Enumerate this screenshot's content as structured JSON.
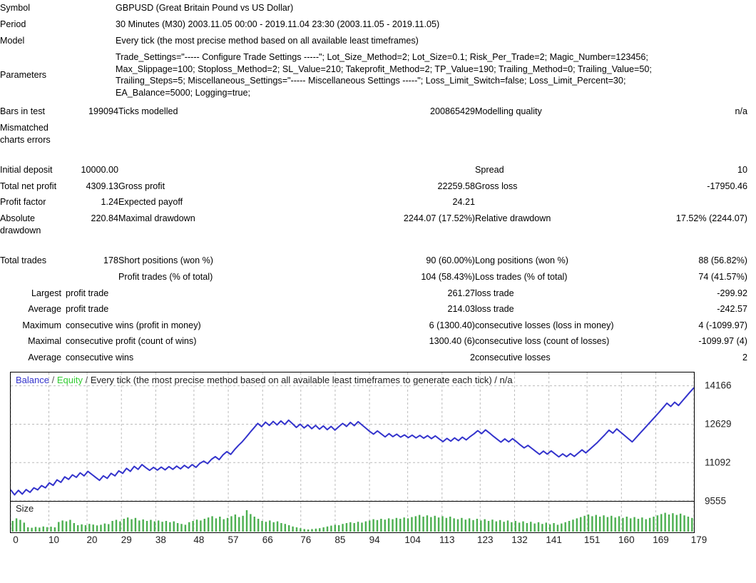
{
  "header": {
    "rows": [
      {
        "label": "Symbol",
        "value": "GBPUSD (Great Britain Pound vs US Dollar)"
      },
      {
        "label": "Period",
        "value": "30 Minutes (M30) 2003.11.05 00:00 - 2019.11.04 23:30 (2003.11.05 - 2019.11.05)"
      },
      {
        "label": "Model",
        "value": "Every tick (the most precise method based on all available least timeframes)"
      }
    ],
    "parameters_label": "Parameters",
    "parameters_lines": [
      "Trade_Settings=\"----- Configure Trade Settings -----\"; Lot_Size_Method=2; Lot_Size=0.1; Risk_Per_Trade=2; Magic_Number=123456;",
      "Max_Slippage=100; Stoploss_Method=2; SL_Value=210; Takeprofit_Method=2; TP_Value=190; Trailing_Method=0; Trailing_Value=50;",
      "Trailing_Steps=5; Miscellaneous_Settings=\"----- Miscellaneous Settings -----\"; Loss_Limit_Switch=false; Loss_Limit_Percent=30;",
      "EA_Balance=5000; Logging=true;"
    ]
  },
  "stats": {
    "bars_in_test_label": "Bars in test",
    "bars_in_test_value": "199094",
    "ticks_modelled_label": "Ticks modelled",
    "ticks_modelled_value": "200865429",
    "modelling_quality_label": "Modelling quality",
    "modelling_quality_value": "n/a",
    "mismatched_label": "Mismatched charts errors",
    "mismatched_value": "",
    "initial_deposit_label": "Initial deposit",
    "initial_deposit_value": "10000.00",
    "spread_label": "Spread",
    "spread_value": "10",
    "total_net_profit_label": "Total net profit",
    "total_net_profit_value": "4309.13",
    "gross_profit_label": "Gross profit",
    "gross_profit_value": "22259.58",
    "gross_loss_label": "Gross loss",
    "gross_loss_value": "-17950.46",
    "profit_factor_label": "Profit factor",
    "profit_factor_value": "1.24",
    "expected_payoff_label": "Expected payoff",
    "expected_payoff_value": "24.21",
    "absolute_drawdown_label": "Absolute drawdown",
    "absolute_drawdown_value": "220.84",
    "maximal_drawdown_label": "Maximal drawdown",
    "maximal_drawdown_value": "2244.07 (17.52%)",
    "relative_drawdown_label": "Relative drawdown",
    "relative_drawdown_value": "17.52% (2244.07)",
    "total_trades_label": "Total trades",
    "total_trades_value": "178",
    "short_positions_label": "Short positions (won %)",
    "short_positions_value": "90 (60.00%)",
    "long_positions_label": "Long positions (won %)",
    "long_positions_value": "88 (56.82%)",
    "profit_trades_label": "Profit trades (% of total)",
    "profit_trades_value": "104 (58.43%)",
    "loss_trades_label": "Loss trades (% of total)",
    "loss_trades_value": "74 (41.57%)",
    "largest_label": "Largest",
    "largest_profit_trade_label": "profit trade",
    "largest_profit_trade_value": "261.27",
    "largest_loss_trade_label": "loss trade",
    "largest_loss_trade_value": "-299.92",
    "average_label": "Average",
    "average_profit_trade_label": "profit trade",
    "average_profit_trade_value": "214.03",
    "average_loss_trade_label": "loss trade",
    "average_loss_trade_value": "-242.57",
    "maximum_label": "Maximum",
    "max_consecutive_wins_label": "consecutive wins (profit in money)",
    "max_consecutive_wins_value": "6 (1300.40)",
    "max_consecutive_losses_label": "consecutive losses (loss in money)",
    "max_consecutive_losses_value": "4 (-1099.97)",
    "maximal_label": "Maximal",
    "maximal_consecutive_profit_label": "consecutive profit (count of wins)",
    "maximal_consecutive_profit_value": "1300.40 (6)",
    "maximal_consecutive_loss_label": "consecutive loss (count of losses)",
    "maximal_consecutive_loss_value": "-1099.97 (4)",
    "average2_label": "Average",
    "avg_consecutive_wins_label": "consecutive wins",
    "avg_consecutive_wins_value": "2",
    "avg_consecutive_losses_label": "consecutive losses",
    "avg_consecutive_losses_value": "2"
  },
  "chart_legend": {
    "balance": "Balance",
    "equity": "Equity",
    "sep": "/",
    "rest": "Every tick (the most precise method based on all available least timeframes to generate each tick) / n/a",
    "size_label": "Size",
    "balance_color": "#3333cc",
    "equity_color": "#33cc33",
    "bar_color": "#4caf50"
  },
  "chart_data": {
    "type": "line",
    "title": "Balance / Equity / Every tick (the most precise method based on all available least timeframes to generate each tick) / n/a",
    "xlabel": "",
    "ylabel": "",
    "ylim": [
      9555,
      14700
    ],
    "yticks": [
      14166,
      12629,
      11092,
      9555
    ],
    "xticks": [
      0,
      10,
      20,
      29,
      38,
      48,
      57,
      66,
      76,
      85,
      94,
      104,
      113,
      123,
      132,
      141,
      151,
      160,
      169,
      179
    ],
    "xlim": [
      0,
      179
    ],
    "grid": true,
    "legend_position": "top-left",
    "series": [
      {
        "name": "Balance",
        "color": "#3333cc",
        "values": [
          10000,
          9800,
          9980,
          9830,
          10010,
          9900,
          10080,
          10000,
          10170,
          10080,
          10280,
          10180,
          10400,
          10300,
          10520,
          10420,
          10600,
          10500,
          10680,
          10560,
          10740,
          10620,
          10500,
          10380,
          10560,
          10460,
          10660,
          10560,
          10760,
          10660,
          10860,
          10740,
          10940,
          10820,
          11010,
          10890,
          10780,
          10900,
          10790,
          10910,
          10800,
          10930,
          10820,
          10950,
          10840,
          10980,
          10870,
          11010,
          10900,
          11060,
          11150,
          11050,
          11220,
          11330,
          11210,
          11400,
          11530,
          11420,
          11610,
          11780,
          11930,
          12110,
          12300,
          12480,
          12660,
          12530,
          12710,
          12580,
          12740,
          12600,
          12760,
          12620,
          12790,
          12650,
          12500,
          12630,
          12480,
          12600,
          12450,
          12580,
          12430,
          12560,
          12410,
          12540,
          12390,
          12530,
          12660,
          12540,
          12700,
          12570,
          12730,
          12600,
          12470,
          12340,
          12230,
          12360,
          12240,
          12120,
          12250,
          12130,
          12230,
          12110,
          12200,
          12090,
          12190,
          12080,
          12180,
          12070,
          12170,
          12050,
          12160,
          12040,
          11930,
          12060,
          11950,
          12080,
          11970,
          12110,
          12000,
          12130,
          12240,
          12370,
          12250,
          12400,
          12280,
          12150,
          12030,
          11910,
          12040,
          11920,
          12050,
          11930,
          11800,
          11680,
          11780,
          11660,
          11540,
          11420,
          11550,
          11430,
          11560,
          11440,
          11320,
          11440,
          11330,
          11450,
          11340,
          11470,
          11600,
          11480,
          11620,
          11760,
          11900,
          12060,
          12220,
          12390,
          12270,
          12440,
          12310,
          12180,
          12050,
          11920,
          12090,
          12260,
          12430,
          12600,
          12770,
          12940,
          13110,
          13290,
          13470,
          13340,
          13510,
          13380,
          13560,
          13740,
          13920,
          14090
        ]
      }
    ],
    "size_panel": {
      "label": "Size",
      "type": "bar",
      "color": "#4caf50",
      "values": [
        0.5,
        0.62,
        0.55,
        0.42,
        0.2,
        0.18,
        0.22,
        0.19,
        0.24,
        0.21,
        0.23,
        0.2,
        0.45,
        0.52,
        0.48,
        0.55,
        0.4,
        0.3,
        0.34,
        0.3,
        0.36,
        0.33,
        0.29,
        0.32,
        0.38,
        0.35,
        0.5,
        0.55,
        0.48,
        0.6,
        0.66,
        0.58,
        0.64,
        0.52,
        0.57,
        0.5,
        0.55,
        0.48,
        0.52,
        0.46,
        0.5,
        0.44,
        0.48,
        0.4,
        0.36,
        0.32,
        0.44,
        0.5,
        0.56,
        0.52,
        0.6,
        0.66,
        0.72,
        0.62,
        0.7,
        0.58,
        0.64,
        0.72,
        0.8,
        0.68,
        0.74,
        1.0,
        0.82,
        0.7,
        0.6,
        0.5,
        0.46,
        0.52,
        0.44,
        0.48,
        0.4,
        0.36,
        0.3,
        0.24,
        0.2,
        0.16,
        0.12,
        0.1,
        0.12,
        0.14,
        0.16,
        0.2,
        0.24,
        0.28,
        0.32,
        0.3,
        0.36,
        0.4,
        0.44,
        0.4,
        0.46,
        0.42,
        0.48,
        0.52,
        0.58,
        0.54,
        0.6,
        0.56,
        0.62,
        0.58,
        0.64,
        0.6,
        0.66,
        0.62,
        0.68,
        0.72,
        0.78,
        0.7,
        0.76,
        0.68,
        0.74,
        0.66,
        0.72,
        0.64,
        0.7,
        0.62,
        0.58,
        0.64,
        0.56,
        0.62,
        0.54,
        0.6,
        0.52,
        0.58,
        0.5,
        0.56,
        0.48,
        0.54,
        0.46,
        0.52,
        0.44,
        0.5,
        0.42,
        0.48,
        0.4,
        0.46,
        0.38,
        0.44,
        0.36,
        0.42,
        0.34,
        0.4,
        0.32,
        0.38,
        0.44,
        0.5,
        0.56,
        0.62,
        0.68,
        0.74,
        0.8,
        0.72,
        0.78,
        0.7,
        0.76,
        0.68,
        0.74,
        0.66,
        0.72,
        0.64,
        0.7,
        0.62,
        0.68,
        0.6,
        0.66,
        0.58,
        0.64,
        0.7,
        0.76,
        0.82,
        0.88,
        0.8,
        0.86,
        0.78,
        0.84,
        0.76,
        0.7,
        0.64
      ]
    }
  }
}
